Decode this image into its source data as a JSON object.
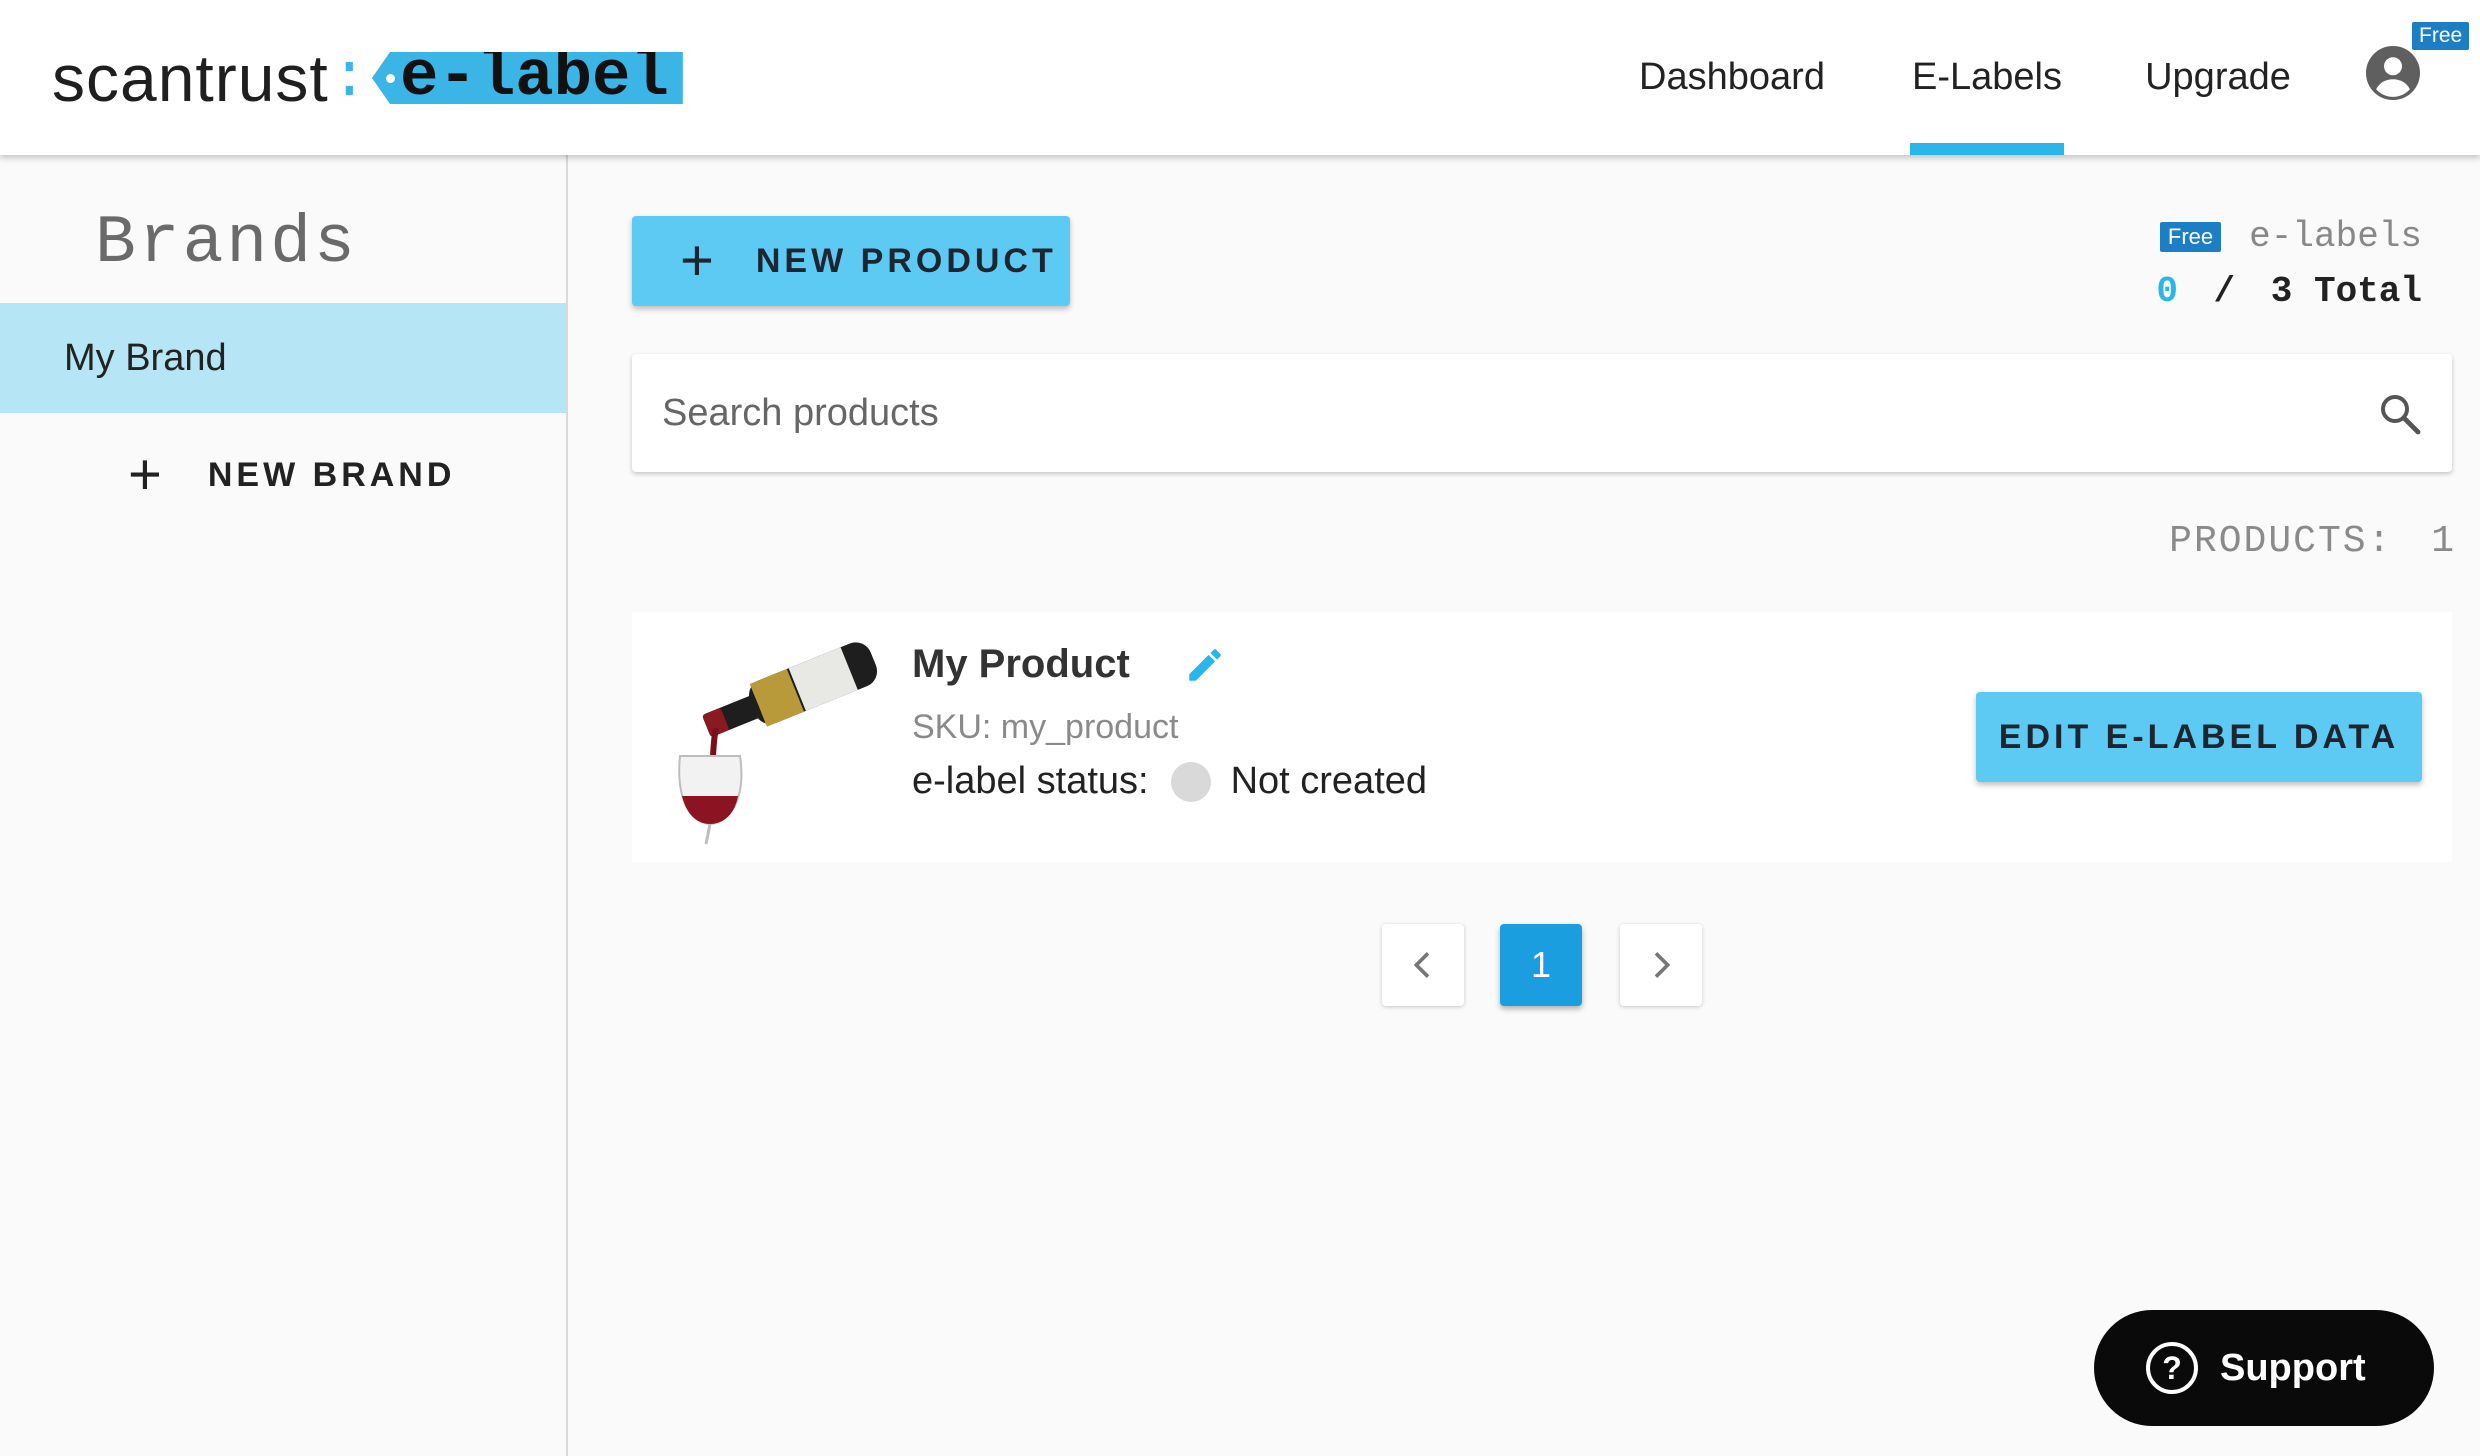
{
  "header": {
    "logo_word": "scantrust",
    "logo_colon": ":",
    "logo_tag": "e-label",
    "nav": [
      {
        "label": "Dashboard"
      },
      {
        "label": "E-Labels",
        "active": true
      },
      {
        "label": "Upgrade"
      }
    ],
    "plan_badge": "Free",
    "account_icon": "account-circle-icon"
  },
  "sidebar": {
    "title": "Brands",
    "brands": [
      {
        "label": "My Brand",
        "selected": true
      }
    ],
    "new_brand_icon": "+",
    "new_brand_label": "NEW BRAND"
  },
  "toolbar": {
    "new_product_icon": "+",
    "new_product_label": "NEW PRODUCT"
  },
  "quota": {
    "plan_badge": "Free",
    "label": "e-labels",
    "used": "0",
    "separator": "/",
    "total": "3 Total"
  },
  "search": {
    "placeholder": "Search products",
    "value": ""
  },
  "products_count": {
    "label": "PRODUCTS:",
    "value": "1"
  },
  "products": [
    {
      "name": "My Product",
      "sku": "SKU: my_product",
      "status_label": "e-label status:",
      "status_value": "Not created",
      "action_label": "EDIT E-LABEL DATA"
    }
  ],
  "pagination": {
    "prev": "‹",
    "current": "1",
    "next": "›"
  },
  "support": {
    "icon": "?",
    "label": "Support"
  },
  "colors": {
    "accent": "#29b6e8",
    "button": "#5ccaf2",
    "selected_brand": "#b6e6f5",
    "badge": "#1c7fc6",
    "pagination_current": "#1a9ee0",
    "support_bg": "#0a0a0a"
  }
}
